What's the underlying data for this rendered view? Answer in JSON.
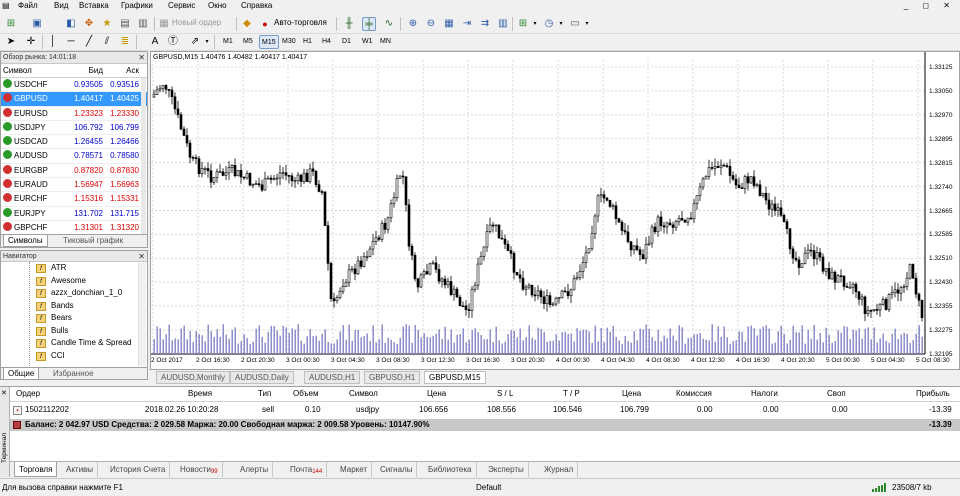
{
  "menu": [
    "Файл",
    "Вид",
    "Вставка",
    "Графики",
    "Сервис",
    "Окно",
    "Справка"
  ],
  "window_controls": "_ ◻ ✕",
  "toolbar": {
    "new_order_label": "Новый ордер",
    "auto_trading_label": "Авто-торговля"
  },
  "timeframes": [
    "M1",
    "M5",
    "M15",
    "M30",
    "H1",
    "H4",
    "D1",
    "W1",
    "MN"
  ],
  "timeframe_active": "M15",
  "market_watch": {
    "title": "Обзор рынка: 14:01:18",
    "close": "✕",
    "headers": {
      "symbol": "Символ",
      "bid": "Бид",
      "ask": "Аск"
    },
    "rows": [
      {
        "symbol": "USDCHF",
        "bid": "0.93505",
        "ask": "0.93516",
        "dir": "up",
        "color": "blue"
      },
      {
        "symbol": "GBPUSD",
        "bid": "1.40417",
        "ask": "1.40425",
        "dir": "down",
        "color": "blue",
        "selected": true
      },
      {
        "symbol": "EURUSD",
        "bid": "1.23323",
        "ask": "1.23330",
        "dir": "down",
        "color": "red"
      },
      {
        "symbol": "USDJPY",
        "bid": "106.792",
        "ask": "106.799",
        "dir": "up",
        "color": "blue"
      },
      {
        "symbol": "USDCAD",
        "bid": "1.26455",
        "ask": "1.26466",
        "dir": "up",
        "color": "blue"
      },
      {
        "symbol": "AUDUSD",
        "bid": "0.78571",
        "ask": "0.78580",
        "dir": "up",
        "color": "blue"
      },
      {
        "symbol": "EURGBP",
        "bid": "0.87820",
        "ask": "0.87830",
        "dir": "down",
        "color": "red"
      },
      {
        "symbol": "EURAUD",
        "bid": "1.56947",
        "ask": "1.56963",
        "dir": "down",
        "color": "red"
      },
      {
        "symbol": "EURCHF",
        "bid": "1.15316",
        "ask": "1.15331",
        "dir": "down",
        "color": "red"
      },
      {
        "symbol": "EURJPY",
        "bid": "131.702",
        "ask": "131.715",
        "dir": "up",
        "color": "blue"
      },
      {
        "symbol": "GBPCHF",
        "bid": "1.31301",
        "ask": "1.31320",
        "dir": "down",
        "color": "red"
      }
    ],
    "tabs": [
      "Символы",
      "Тиковый график"
    ]
  },
  "navigator": {
    "title": "Навигатор",
    "close": "✕",
    "items": [
      "ATR",
      "Awesome",
      "azzx_donchian_1_0",
      "Bands",
      "Bears",
      "Bulls",
      "Candle Time & Spread",
      "CCI"
    ],
    "tabs": [
      "Общие",
      "Избранное"
    ]
  },
  "chart": {
    "title": "GBPUSD,M15  1.40476 1.40482 1.40417 1.40417",
    "price_labels": [
      "1.33125",
      "1.33050",
      "1.32970",
      "1.32895",
      "1.32815",
      "1.32740",
      "1.32665",
      "1.32585",
      "1.32510",
      "1.32430",
      "1.32355",
      "1.32275",
      "1.32195"
    ],
    "time_labels": [
      "2 Oct 2017",
      "2 Oct 16:30",
      "2 Oct 20:30",
      "3 Oct 00:30",
      "3 Oct 04:30",
      "3 Oct 08:30",
      "3 Oct 12:30",
      "3 Oct 16:30",
      "3 Oct 20:30",
      "4 Oct 00:30",
      "4 Oct 04:30",
      "4 Oct 08:30",
      "4 Oct 12:30",
      "4 Oct 16:30",
      "4 Oct 20:30",
      "5 Oct 00:30",
      "5 Oct 04:30",
      "5 Oct 08:30"
    ],
    "tabs": [
      "AUDUSD,Monthly",
      "AUDUSD,Daily",
      "AUDUSD,H1",
      "GBPUSD,H1",
      "GBPUSD,M15"
    ]
  },
  "terminal": {
    "side_label": "Терминал",
    "close": "✕",
    "headers": [
      "Ордер",
      "Время",
      "Тип",
      "Объем",
      "Символ",
      "Цена",
      "S / L",
      "T / P",
      "Цена",
      "Комиссия",
      "Налоги",
      "Своп",
      "Прибыль"
    ],
    "order": {
      "id": "1502112202",
      "time": "2018.02.26 10:20:28",
      "type": "sell",
      "volume": "0.10",
      "symbol": "usdjpy",
      "price": "106.656",
      "sl": "108.556",
      "tp": "106.546",
      "current": "106.799",
      "commission": "0.00",
      "taxes": "0.00",
      "swap": "0.00",
      "profit": "-13.39"
    },
    "balance_line": "Баланс: 2 042.97 USD  Средства: 2 029.58  Маржа: 20.00  Свободная маржа: 2 009.58  Уровень: 10147.90%",
    "balance_profit": "-13.39",
    "tabs": [
      {
        "label": "Торговля",
        "badge": ""
      },
      {
        "label": "Активы",
        "badge": ""
      },
      {
        "label": "История Счета",
        "badge": ""
      },
      {
        "label": "Новости",
        "badge": "99"
      },
      {
        "label": "Алерты",
        "badge": ""
      },
      {
        "label": "Почта",
        "badge": "144"
      },
      {
        "label": "Маркет",
        "badge": ""
      },
      {
        "label": "Сигналы",
        "badge": ""
      },
      {
        "label": "Библиотека",
        "badge": ""
      },
      {
        "label": "Эксперты",
        "badge": ""
      },
      {
        "label": "Журнал",
        "badge": ""
      }
    ]
  },
  "status_bar": {
    "help": "Для вызова справки нажмите F1",
    "profile": "Default",
    "traffic": "23508/7 kb"
  },
  "colors": {
    "selected_row": "#3399ff",
    "bid_up": "#0000cc",
    "bid_down": "#dd0000",
    "candles": "#000000",
    "volume": "#8484c8"
  }
}
